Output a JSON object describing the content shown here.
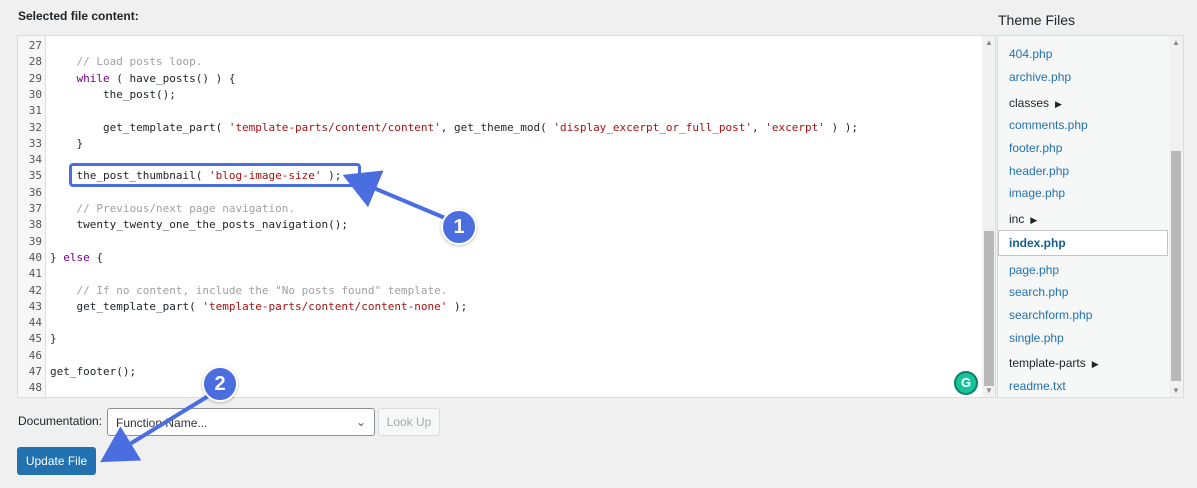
{
  "header": {
    "label": "Selected file content:"
  },
  "editor": {
    "lines": [
      {
        "n": "27",
        "tokens": []
      },
      {
        "n": "28",
        "tokens": [
          {
            "t": "    ",
            "c": "fn"
          },
          {
            "t": "// Load posts loop.",
            "c": "cm"
          }
        ]
      },
      {
        "n": "29",
        "tokens": [
          {
            "t": "    ",
            "c": "fn"
          },
          {
            "t": "while",
            "c": "kw"
          },
          {
            "t": " ( have_posts() ) {",
            "c": "fn"
          }
        ]
      },
      {
        "n": "30",
        "tokens": [
          {
            "t": "        the_post();",
            "c": "fn"
          }
        ]
      },
      {
        "n": "31",
        "tokens": []
      },
      {
        "n": "32",
        "tokens": [
          {
            "t": "        get_template_part( ",
            "c": "fn"
          },
          {
            "t": "'template-parts/content/content'",
            "c": "str"
          },
          {
            "t": ", get_theme_mod( ",
            "c": "fn"
          },
          {
            "t": "'display_excerpt_or_full_post'",
            "c": "str"
          },
          {
            "t": ", ",
            "c": "fn"
          },
          {
            "t": "'excerpt'",
            "c": "str"
          },
          {
            "t": " ) );",
            "c": "fn"
          }
        ]
      },
      {
        "n": "33",
        "tokens": [
          {
            "t": "    }",
            "c": "fn"
          }
        ]
      },
      {
        "n": "34",
        "tokens": []
      },
      {
        "n": "35",
        "tokens": [
          {
            "t": "    the_post_thumbnail( ",
            "c": "fn"
          },
          {
            "t": "'blog-image-size'",
            "c": "str"
          },
          {
            "t": " );",
            "c": "fn"
          }
        ]
      },
      {
        "n": "36",
        "tokens": []
      },
      {
        "n": "37",
        "tokens": [
          {
            "t": "    ",
            "c": "fn"
          },
          {
            "t": "// Previous/next page navigation.",
            "c": "cm"
          }
        ]
      },
      {
        "n": "38",
        "tokens": [
          {
            "t": "    twenty_twenty_one_the_posts_navigation();",
            "c": "fn"
          }
        ]
      },
      {
        "n": "39",
        "tokens": []
      },
      {
        "n": "40",
        "tokens": [
          {
            "t": "} ",
            "c": "fn"
          },
          {
            "t": "else",
            "c": "kw"
          },
          {
            "t": " {",
            "c": "fn"
          }
        ]
      },
      {
        "n": "41",
        "tokens": []
      },
      {
        "n": "42",
        "tokens": [
          {
            "t": "    ",
            "c": "fn"
          },
          {
            "t": "// If no content, include the \"No posts found\" template.",
            "c": "cm"
          }
        ]
      },
      {
        "n": "43",
        "tokens": [
          {
            "t": "    get_template_part( ",
            "c": "fn"
          },
          {
            "t": "'template-parts/content/content-none'",
            "c": "str"
          },
          {
            "t": " );",
            "c": "fn"
          }
        ]
      },
      {
        "n": "44",
        "tokens": []
      },
      {
        "n": "45",
        "tokens": [
          {
            "t": "}",
            "c": "fn"
          }
        ]
      },
      {
        "n": "46",
        "tokens": []
      },
      {
        "n": "47",
        "tokens": [
          {
            "t": "get_footer();",
            "c": "fn"
          }
        ]
      },
      {
        "n": "48",
        "tokens": []
      }
    ]
  },
  "theme_files": {
    "title": "Theme Files",
    "items": [
      {
        "label": "404.php",
        "type": "file"
      },
      {
        "label": "archive.php",
        "type": "file"
      },
      {
        "label": "classes",
        "type": "dir"
      },
      {
        "label": "comments.php",
        "type": "file"
      },
      {
        "label": "footer.php",
        "type": "file"
      },
      {
        "label": "header.php",
        "type": "file"
      },
      {
        "label": "image.php",
        "type": "file"
      },
      {
        "label": "inc",
        "type": "dir"
      },
      {
        "label": "index.php",
        "type": "current"
      },
      {
        "label": "page.php",
        "type": "file"
      },
      {
        "label": "search.php",
        "type": "file"
      },
      {
        "label": "searchform.php",
        "type": "file"
      },
      {
        "label": "single.php",
        "type": "file"
      },
      {
        "label": "template-parts",
        "type": "dir"
      },
      {
        "label": "readme.txt",
        "type": "file"
      }
    ]
  },
  "documentation": {
    "label": "Documentation:",
    "selected": "Function Name...",
    "lookup_label": "Look Up"
  },
  "update_button": {
    "label": "Update File"
  },
  "annotations": {
    "badge1": "1",
    "badge2": "2"
  },
  "icons": {
    "grammarly": "grammarly-icon",
    "dropdown": "chevron-down-icon"
  },
  "colors": {
    "accent": "#4a6ee0",
    "primary_button": "#2271b1",
    "link": "#2271b1"
  }
}
